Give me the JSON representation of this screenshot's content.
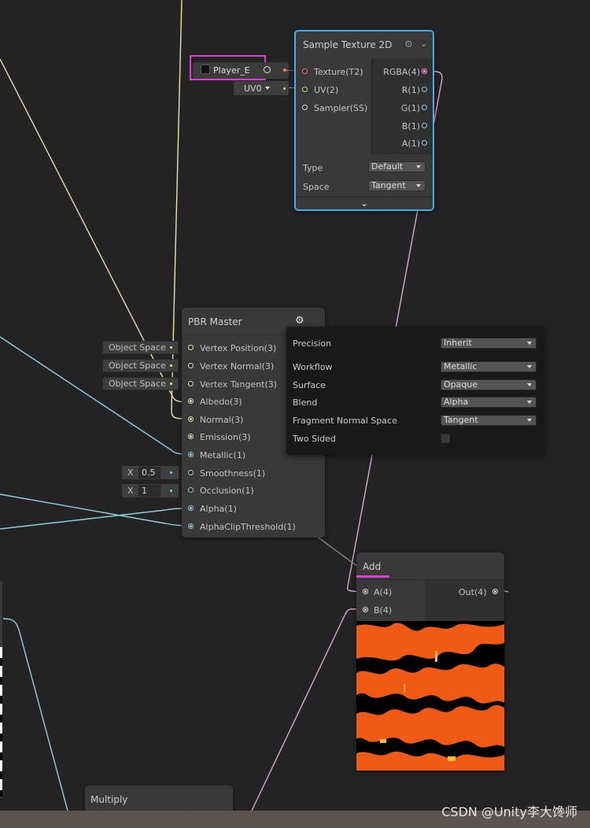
{
  "property_chip": {
    "label": "Player_E"
  },
  "uv_chip": {
    "label": "UV0"
  },
  "sample_texture": {
    "title": "Sample Texture 2D",
    "inputs": [
      "Texture(T2)",
      "UV(2)",
      "Sampler(SS)"
    ],
    "outputs": [
      "RGBA(4)",
      "R(1)",
      "G(1)",
      "B(1)",
      "A(1)"
    ],
    "type_label": "Type",
    "type_value": "Default",
    "space_label": "Space",
    "space_value": "Tangent"
  },
  "pbr_master": {
    "title": "PBR Master",
    "inputs": [
      "Vertex Position(3)",
      "Vertex Normal(3)",
      "Vertex Tangent(3)",
      "Albedo(3)",
      "Normal(3)",
      "Emission(3)",
      "Metallic(1)",
      "Smoothness(1)",
      "Occlusion(1)",
      "Alpha(1)",
      "AlphaClipThreshold(1)"
    ],
    "space_chips": [
      "Object Space",
      "Object Space",
      "Object Space"
    ],
    "smoothness": {
      "x": "X",
      "value": "0.5"
    },
    "occlusion": {
      "x": "X",
      "value": "1"
    }
  },
  "settings_popup": {
    "rows": [
      {
        "label": "Precision",
        "value": "Inherit"
      },
      {
        "label": "Workflow",
        "value": "Metallic"
      },
      {
        "label": "Surface",
        "value": "Opaque"
      },
      {
        "label": "Blend",
        "value": "Alpha"
      },
      {
        "label": "Fragment Normal Space",
        "value": "Tangent"
      }
    ],
    "two_sided_label": "Two Sided",
    "two_sided": false
  },
  "add_node": {
    "title": "Add",
    "inputs": [
      "A(4)",
      "B(4)"
    ],
    "output": "Out(4)"
  },
  "multiply_node": {
    "title": "Multiply"
  },
  "watermark": "CSDN @Unity李大馋师",
  "colors": {
    "accent_selection": "#d93fd5",
    "node_bg": "#393939",
    "canvas_bg": "#232323",
    "highlight_border": "#4aa9e6",
    "preview_orange": "#f05a14"
  }
}
